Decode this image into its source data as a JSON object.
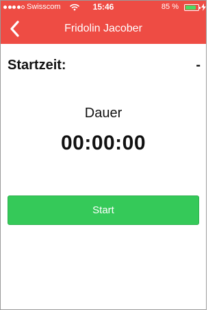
{
  "status_bar": {
    "signal_bars_filled": 4,
    "signal_bars_total": 5,
    "carrier": "Swisscom",
    "time": "15:46",
    "battery_percent_text": "85 %",
    "battery_level": 0.85
  },
  "nav": {
    "title": "Fridolin Jacober"
  },
  "start": {
    "label": "Startzeit:",
    "value": "-"
  },
  "duration": {
    "label": "Dauer",
    "value": "00:00:00"
  },
  "actions": {
    "start_label": "Start"
  },
  "colors": {
    "header": "#ee4c44",
    "button": "#35c959",
    "battery_fill": "#4cd964"
  },
  "icons": {
    "back": "chevron-left-icon",
    "wifi": "wifi-icon",
    "battery": "battery-icon",
    "charging": "lightning-bolt-icon"
  }
}
